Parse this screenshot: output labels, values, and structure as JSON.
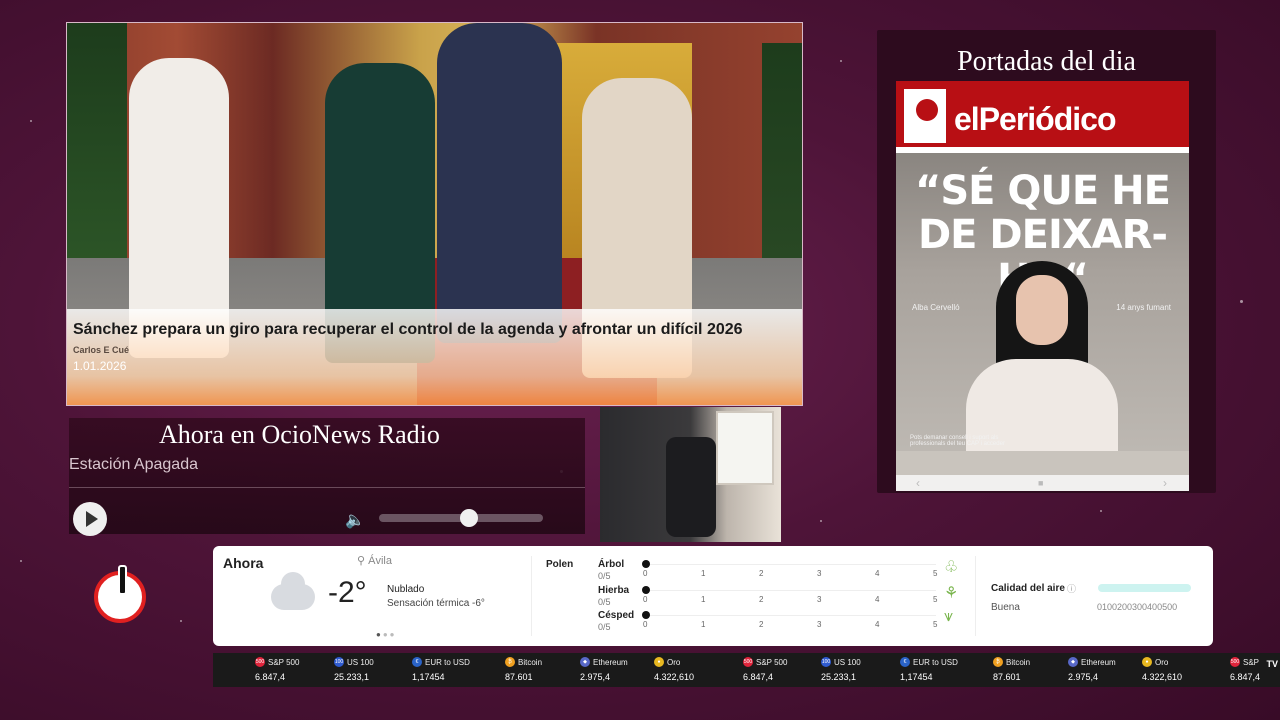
{
  "news": {
    "headline": "Sánchez prepara un giro para recuperar el control de la agenda y afrontar un difícil 2026",
    "author": "Carlos E Cué",
    "date": "1.01.2026"
  },
  "portadas": {
    "title": "Portadas del dia",
    "cover": {
      "logo": "elPeriódico",
      "quote_line1": "“SÉ QUE HE",
      "quote_line2": "DE DEIXAR-HO“",
      "caption_left": "Alba Cervelló",
      "caption_right": "14 anys fumant",
      "footer": "Pots demanar consell i suport als professionals del teu CAP i acceder"
    }
  },
  "radio": {
    "title": "Ahora en OcioNews Radio",
    "station": "Estación Apagada",
    "volume_level": 0.55
  },
  "weather": {
    "now_label": "Ahora",
    "location": "Ávila",
    "temperature": "-2°",
    "condition": "Nublado",
    "feels_like": "Sensación térmica -6°",
    "polen_label": "Polen",
    "polen": [
      {
        "name": "Árbol",
        "score": "0/5",
        "icon": "tree-icon"
      },
      {
        "name": "Hierba",
        "score": "0/5",
        "icon": "herb-icon"
      },
      {
        "name": "Césped",
        "score": "0/5",
        "icon": "grass-icon"
      }
    ],
    "scale": [
      "0",
      "1",
      "2",
      "3",
      "4",
      "5"
    ],
    "air_quality_label": "Calidad del aire",
    "air_quality_status": "Buena",
    "air_quality_scale": "0100200300400500"
  },
  "ticker": [
    {
      "name": "S&P 500",
      "value": "6.847,4",
      "icon_color": "#e0243b",
      "icon_text": "500"
    },
    {
      "name": "US 100",
      "value": "25.233,1",
      "icon_color": "#2f5bd0",
      "icon_text": "100"
    },
    {
      "name": "EUR to USD",
      "value": "1,17454",
      "icon_color": "#2a63c8",
      "icon_text": "€"
    },
    {
      "name": "Bitcoin",
      "value": "87.601",
      "icon_color": "#f0a020",
      "icon_text": "₿"
    },
    {
      "name": "Ethereum",
      "value": "2.975,4",
      "icon_color": "#5868c8",
      "icon_text": "◆"
    },
    {
      "name": "Oro",
      "value": "4.322,610",
      "icon_color": "#e8b820",
      "icon_text": "●"
    },
    {
      "name": "S&P 500",
      "value": "6.847,4",
      "icon_color": "#e0243b",
      "icon_text": "500"
    },
    {
      "name": "US 100",
      "value": "25.233,1",
      "icon_color": "#2f5bd0",
      "icon_text": "100"
    },
    {
      "name": "EUR to USD",
      "value": "1,17454",
      "icon_color": "#2a63c8",
      "icon_text": "€"
    },
    {
      "name": "Bitcoin",
      "value": "87.601",
      "icon_color": "#f0a020",
      "icon_text": "₿"
    },
    {
      "name": "Ethereum",
      "value": "2.975,4",
      "icon_color": "#5868c8",
      "icon_text": "◆"
    },
    {
      "name": "Oro",
      "value": "4.322,610",
      "icon_color": "#e8b820",
      "icon_text": "●"
    },
    {
      "name": "S&P",
      "value": "6.847,4",
      "icon_color": "#e0243b",
      "icon_text": "500"
    }
  ],
  "ticker_brand": "TV"
}
